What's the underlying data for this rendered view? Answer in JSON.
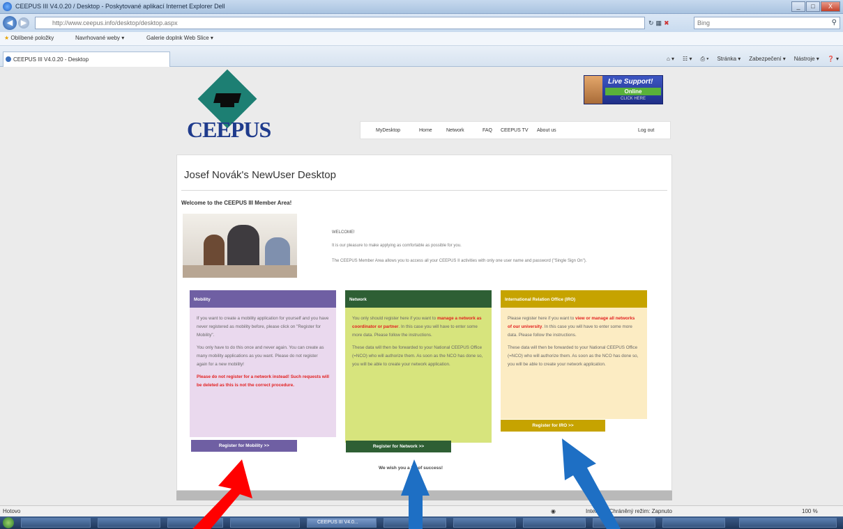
{
  "browser": {
    "window_title": "CEEPUS III V4.0.20 / Desktop - Poskytované aplikací Internet Explorer Dell",
    "window_buttons": [
      "_",
      "□",
      "X"
    ],
    "address": "http://www.ceepus.info/desktop/desktop.aspx",
    "address_domain": "ceepus.info",
    "search_placeholder": "Bing",
    "favorites_label": "Oblíbené položky",
    "fav_item_1": "Navrhované weby ▾",
    "fav_item_2": "Galerie doplnk Web Slice ▾",
    "tab_title": "CEEPUS III V4.0.20 - Desktop",
    "commands": [
      "Stránka ▾",
      "Zabezpečení ▾",
      "Nástroje ▾"
    ]
  },
  "page": {
    "logo_text": "CEEPUS",
    "live_support": {
      "title": "Live Support!",
      "status": "Online",
      "hint": "CLICK HERE"
    },
    "nav": {
      "items": [
        "MyDesktop",
        "Home",
        "Network",
        "FAQ",
        "CEEPUS TV",
        "About us"
      ],
      "logout": "Log out"
    },
    "title": "Josef Novák's NewUser Desktop",
    "welcome_heading": "Welcome to the CEEPUS III Member Area!",
    "welcome_label": "WELCOME!",
    "welcome_text_1": "It is our pleasure to make applying as comfortable as possible for you.",
    "welcome_text_2": "The CEEPUS Member Area allows you to access all your CEEPUS II activities with only one user name and password (\"Single Sign On\").",
    "mobility": {
      "heading": "Mobility",
      "p1": "If you want to create a mobility application for yourself and you have never registered as mobility before, please click on \"Register for Mobility\".",
      "p2": "You only have to do this once and never again. You can create as many mobility applications as you want. Please do not register again for a new mobility!",
      "warning": "Please do not register for a network instead! Such requests will be deleted as this is not the correct procedure.",
      "button": "Register for Mobility >>"
    },
    "network": {
      "heading": "Network",
      "p1_pre": "You only should register here if you want to ",
      "p1_red": "manage a network as coordinator or partner",
      "p1_post": ". In this case you will have to enter some more data. Please follow the instructions.",
      "p2": "These data will then be forwarded to your National CEEPUS Office (=NCO) who will authorize them. As soon as the NCO has done so, you will be able to create your network application.",
      "button": "Register for Network >>"
    },
    "iro": {
      "heading": "International Relation Office (IRO)",
      "p1_pre": "Please register here if you want to ",
      "p1_red": "view or manage all networks of our university",
      "p1_post": ". In this case you will have to enter some more data. Please follow the instructions.",
      "p2": "These data will then be forwarded to your National CEEPUS Office (=NCO) who will authorize them. As soon as the NCO has done so, you will be able to create your network application.",
      "button": "Register for IRO >>"
    },
    "good_luck": "We wish you a lot of success!"
  },
  "statusbar": {
    "left": "Hotovo",
    "zone": "Internet | Chráněný režim: Zapnuto",
    "zoom": "100 %"
  },
  "taskbar": {
    "active": "CEEPUS III V4.0..."
  },
  "colors": {
    "mobility_header": "#6f5fa3",
    "mobility_body": "#ead9ee",
    "network_header": "#2e5f34",
    "network_body": "#d7e47d",
    "iro_header": "#c6a300",
    "iro_body": "#fcecc3",
    "arrow_red": "#ff0000",
    "arrow_blue": "#1e6fc4"
  }
}
